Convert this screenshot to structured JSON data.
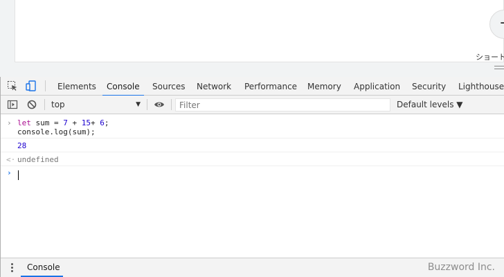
{
  "page": {
    "shortcut_plus": "+",
    "shortcut_label": "ショート"
  },
  "devtools": {
    "tabs": [
      "Elements",
      "Console",
      "Sources",
      "Network",
      "Performance",
      "Memory",
      "Application",
      "Security",
      "Lighthouse"
    ],
    "active_tab": "Console",
    "toolbar": {
      "context": "top",
      "filter_placeholder": "Filter",
      "levels": "Default levels ▼"
    },
    "console": {
      "input_line1": {
        "kw": "let",
        "mid": " sum = ",
        "n1": "7",
        "op1": " + ",
        "n2": "15",
        "op2": "+ ",
        "n3": "6",
        "end": ";"
      },
      "input_line2": "console.log(sum);",
      "log_output": "28",
      "return_value": "undefined"
    },
    "drawer": {
      "tab": "Console"
    }
  },
  "watermark": "Buzzword Inc.",
  "colors": {
    "accent": "#1a73e8",
    "keyword": "#aa0d91",
    "number": "#1c00cf"
  }
}
